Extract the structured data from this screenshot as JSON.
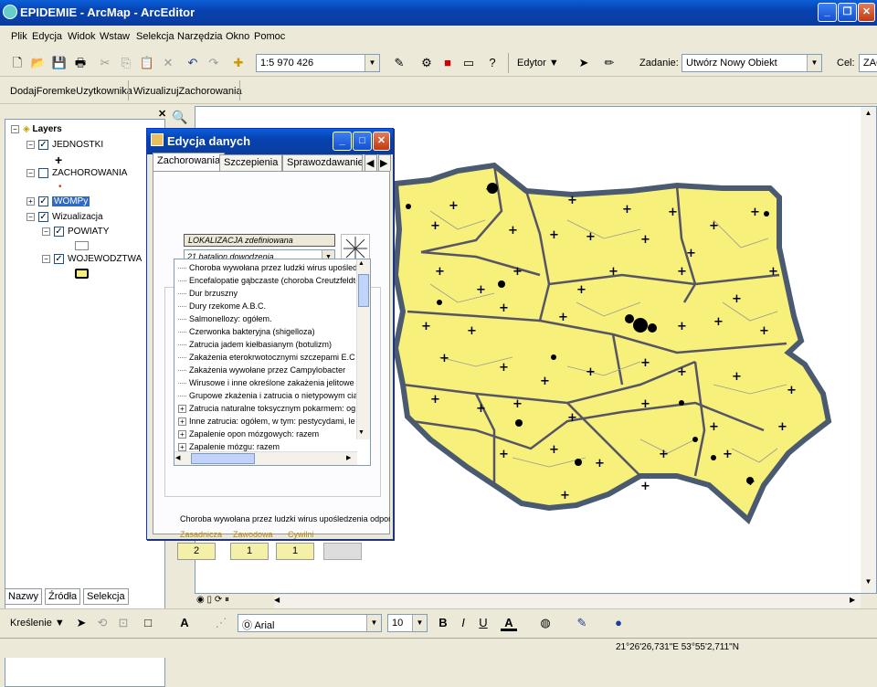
{
  "window": {
    "title": "EPIDEMIE - ArcMap - ArcEditor"
  },
  "menu": [
    "Plik",
    "Edycja",
    "Widok",
    "Wstaw",
    "Selekcja",
    "Narzędzia",
    "Okno",
    "Pomoc"
  ],
  "toolbar": {
    "scale": "1:5 970 426",
    "editor_label": "Edytor",
    "task_label": "Zadanie:",
    "task_value": "Utwórz Nowy Obiekt",
    "target_label": "Cel:",
    "target_value": "ZAC",
    "custom_buttons": [
      "DodajForemkeUzytkownika",
      "WizualizujZachorowania"
    ]
  },
  "toc": {
    "root": "Layers",
    "layers": [
      {
        "name": "JEDNOSTKI",
        "checked": true
      },
      {
        "name": "ZACHOROWANIA",
        "checked": false
      },
      {
        "name": "WOMPy",
        "checked": true,
        "selected": true
      },
      {
        "name": "Wizualizacja",
        "checked": true
      },
      {
        "name": "POWIATY",
        "checked": true
      },
      {
        "name": "WOJEWODZTWA",
        "checked": true
      }
    ],
    "tabs": [
      "Nazwy",
      "Źródła",
      "Selekcja"
    ]
  },
  "dialog": {
    "title": "Edycja danych",
    "tabs": [
      "Zachorowania",
      "Szczepienia",
      "Sprawozdawanie"
    ],
    "lokalizacja": "LOKALIZACJA zdefiniowana",
    "unit": "21 batalion dowodzenia",
    "diseases": [
      {
        "label": "Choroba wywołana przez ludzki wirus upośledz",
        "expand": false
      },
      {
        "label": "Encefalopatie gąbczaste (choroba Creutzfeldt-",
        "expand": false
      },
      {
        "label": "Dur brzuszny",
        "expand": false
      },
      {
        "label": "Dury rzekome A.B.C.",
        "expand": false
      },
      {
        "label": "Salmonellozy: ogółem.",
        "expand": false
      },
      {
        "label": "Czerwonka  bakteryjna (shigelloza)",
        "expand": false
      },
      {
        "label": "Zatrucia jadem kiełbasianym (botulizm)",
        "expand": false
      },
      {
        "label": "Zakażenia eterokrwotocznymi szczepami E.C",
        "expand": false
      },
      {
        "label": "Zakażenia wywołane przez Campylobacter",
        "expand": false
      },
      {
        "label": "Wirusowe i inne określone zakażenia jelitowe",
        "expand": false
      },
      {
        "label": "Grupowe zkażenia i zatrucia o nietypowym ciąg",
        "expand": false
      },
      {
        "label": "Zatrucia naturalne toksycznym pokarmem: og",
        "expand": true
      },
      {
        "label": "Inne zatrucia: ogółem, w tym: pestycydami, le",
        "expand": true
      },
      {
        "label": "Zapalenie opon mózgowych: razem",
        "expand": true
      },
      {
        "label": "Zapalenie mózgu: razem",
        "expand": true
      }
    ],
    "selected_disease": "Choroba wywołana przez ludzki wirus upośledzenia odporności",
    "fields": [
      {
        "label": "Zasadnicza",
        "value": "2"
      },
      {
        "label": "Zawodowa",
        "value": "1"
      },
      {
        "label": "Cywilni",
        "value": "1"
      }
    ]
  },
  "drawing": {
    "label": "Kreślenie",
    "font": "Arial",
    "size": "10"
  },
  "status": {
    "coords": "21°26'26,731\"E  53°55'2,711\"N"
  },
  "colors": {
    "map_fill": "#f7f07a",
    "title_blue": "#0a5fd8"
  }
}
